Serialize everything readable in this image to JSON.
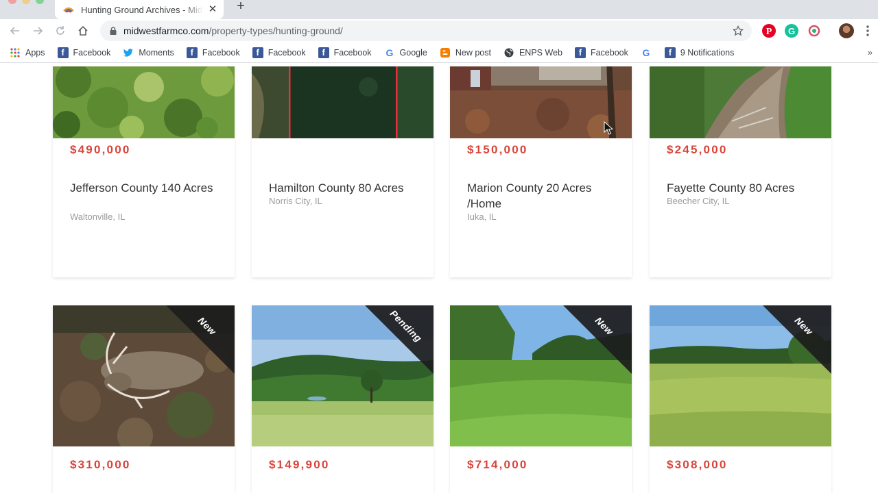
{
  "tab": {
    "title": "Hunting Ground Archives - Midwest Farm Co",
    "close": "✕",
    "new_tab": "+"
  },
  "address_bar": {
    "domain": "midwestfarmco.com",
    "path": "/property-types/hunting-ground/"
  },
  "bookmarks": [
    {
      "label": "Apps",
      "icon": "apps-grid-icon"
    },
    {
      "label": "Facebook",
      "icon": "facebook-icon"
    },
    {
      "label": "Moments",
      "icon": "twitter-icon"
    },
    {
      "label": "Facebook",
      "icon": "facebook-icon"
    },
    {
      "label": "Facebook",
      "icon": "facebook-icon"
    },
    {
      "label": "Facebook",
      "icon": "facebook-icon"
    },
    {
      "label": "Google",
      "icon": "google-icon"
    },
    {
      "label": "New post",
      "icon": "blogger-icon"
    },
    {
      "label": "ENPS Web",
      "icon": "globe-icon"
    },
    {
      "label": "Facebook",
      "icon": "facebook-icon"
    },
    {
      "label": "",
      "icon": "google-icon"
    },
    {
      "label": "9 Notifications",
      "icon": "facebook-icon"
    }
  ],
  "bookmarks_overflow": "»",
  "colors": {
    "price": "#d9443a",
    "ribbon": "#1d1d1d"
  },
  "listings_row1": [
    {
      "price": "$490,000",
      "title": "Jefferson County 140 Acres",
      "location": "Waltonville, IL",
      "image": "aerial-forest-photo"
    },
    {
      "price": "",
      "title": "Hamilton County 80 Acres",
      "location": "Norris City, IL",
      "image": "aerial-boundary-photo"
    },
    {
      "price": "$150,000",
      "title": "Marion County 20 Acres /Home",
      "location": "Iuka, IL",
      "image": "house-leaves-photo"
    },
    {
      "price": "$245,000",
      "title": "Fayette County 80 Acres",
      "location": "Beecher City, IL",
      "image": "creek-photo"
    }
  ],
  "listings_row2": [
    {
      "price": "$310,000",
      "badge": "New",
      "image": "deer-photo"
    },
    {
      "price": "$149,900",
      "badge": "Pending",
      "image": "pasture-treeline-photo"
    },
    {
      "price": "$714,000",
      "badge": "New",
      "image": "grass-field-photo"
    },
    {
      "price": "$308,000",
      "badge": "New",
      "image": "open-field-photo"
    }
  ]
}
